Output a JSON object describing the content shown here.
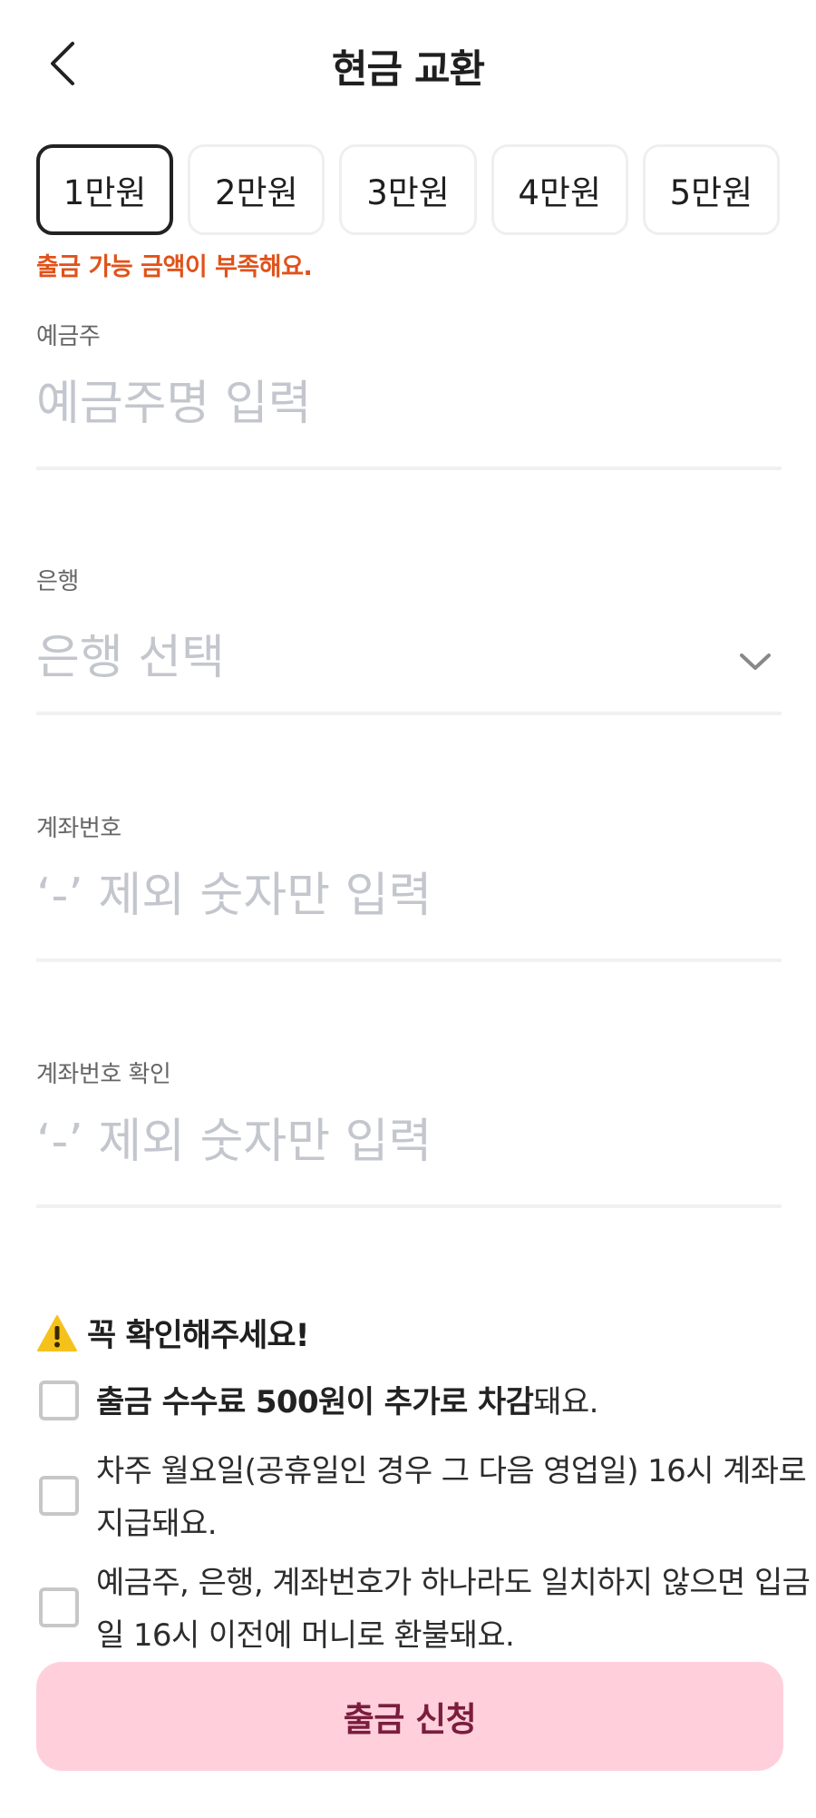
{
  "header": {
    "title": "현금 교환",
    "back_icon": "chevron-left-icon"
  },
  "amounts": {
    "options": [
      "1만원",
      "2만원",
      "3만원",
      "4만원",
      "5만원"
    ],
    "selected": "1만원",
    "error": "출금 가능 금액이 부족해요."
  },
  "form": {
    "holder": {
      "label": "예금주",
      "placeholder": "예금주명 입력",
      "value": ""
    },
    "bank": {
      "label": "은행",
      "placeholder": "은행 선택",
      "icon": "chevron-down-icon"
    },
    "account": {
      "label": "계좌번호",
      "placeholder": "‘-’ 제외 숫자만 입력",
      "value": ""
    },
    "account_confirm": {
      "label": "계좌번호 확인",
      "placeholder": "‘-’ 제외 숫자만 입력",
      "value": ""
    }
  },
  "notice": {
    "icon": "warning-icon",
    "title": "꼭 확인해주세요!",
    "items": [
      {
        "bold": "출금 수수료 500원이 추가로 차감",
        "rest": "돼요.",
        "checked": false
      },
      {
        "bold": "",
        "rest": "차주 월요일(공휴일인 경우 그 다음 영업일) 16시 계좌로 지급돼요.",
        "checked": false
      },
      {
        "bold": "",
        "rest": "예금주, 은행, 계좌번호가 하나라도 일치하지 않으면 입금일 16시 이전에 머니로 환불돼요.",
        "checked": false
      }
    ]
  },
  "submit": {
    "label": "출금 신청"
  },
  "colors": {
    "error": "#e0521a",
    "placeholder": "#c3c6cd",
    "submit_bg": "#ffd0dc",
    "submit_text": "#7a1d3e",
    "warning": "#f5c21b"
  }
}
